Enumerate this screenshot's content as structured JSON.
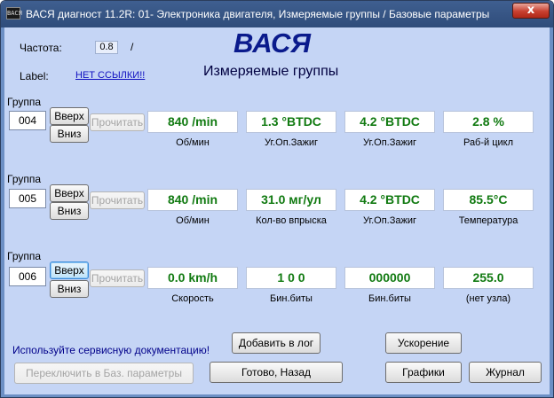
{
  "window": {
    "icon_text": "ВАСЯ",
    "title": "ВАСЯ диагност 11.2R: 01- Электроника двигателя,  Измеряемые группы / Базовые параметры",
    "close_label": "x"
  },
  "header": {
    "freq_label": "Частота:",
    "freq_value": "0.8",
    "freq_suffix": "/",
    "label_label": "Label:",
    "label_link": "НЕТ ССЫЛКИ!!",
    "brand": "ВАСЯ",
    "subtitle": "Измеряемые группы"
  },
  "groups": [
    {
      "label": "Группа",
      "number": "004",
      "up": "Вверх",
      "down": "Вниз",
      "read": "Прочитать",
      "values": [
        {
          "value": "840 /min",
          "caption": "Об/мин"
        },
        {
          "value": "1.3 °BTDC",
          "caption": "Уг.Оп.Зажиг"
        },
        {
          "value": "4.2 °BTDC",
          "caption": "Уг.Оп.Зажиг"
        },
        {
          "value": "2.8 %",
          "caption": "Раб-й цикл"
        }
      ]
    },
    {
      "label": "Группа",
      "number": "005",
      "up": "Вверх",
      "down": "Вниз",
      "read": "Прочитать",
      "values": [
        {
          "value": "840 /min",
          "caption": "Об/мин"
        },
        {
          "value": "31.0 мг/ул",
          "caption": "Кол-во впрыска"
        },
        {
          "value": "4.2 °BTDC",
          "caption": "Уг.Оп.Зажиг"
        },
        {
          "value": "85.5°C",
          "caption": "Температура"
        }
      ]
    },
    {
      "label": "Группа",
      "number": "006",
      "up": "Вверх",
      "down": "Вниз",
      "read": "Прочитать",
      "values": [
        {
          "value": "0.0 km/h",
          "caption": "Скорость"
        },
        {
          "value": "1  0  0",
          "caption": "Бин.биты"
        },
        {
          "value": "000000",
          "caption": "Бин.биты"
        },
        {
          "value": "255.0",
          "caption": "(нет узла)"
        }
      ]
    }
  ],
  "footer": {
    "hint": "Используйте сервисную документацию!",
    "add_log": "Добавить в лог",
    "acceleration": "Ускорение",
    "switch_basic": "Переключить в Баз. параметры",
    "done_back": "Готово, Назад",
    "graphs": "Графики",
    "journal": "Журнал"
  }
}
